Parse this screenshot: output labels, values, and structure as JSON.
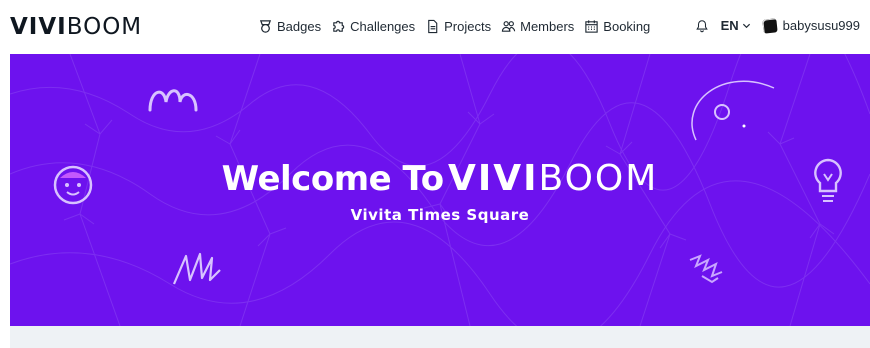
{
  "header": {
    "logo_bold": "VIVI",
    "logo_light": "BOOM",
    "nav": [
      {
        "label": "Badges",
        "icon": "badge-icon"
      },
      {
        "label": "Challenges",
        "icon": "puzzle-icon"
      },
      {
        "label": "Projects",
        "icon": "document-icon"
      },
      {
        "label": "Members",
        "icon": "members-icon"
      },
      {
        "label": "Booking",
        "icon": "calendar-icon"
      }
    ],
    "language": "EN",
    "username": "babysusu999"
  },
  "banner": {
    "welcome": "Welcome To",
    "brand_bold": "VIVI",
    "brand_light": "BOOM",
    "subtitle": "Vivita Times Square",
    "background_color": "#6d12ee"
  }
}
